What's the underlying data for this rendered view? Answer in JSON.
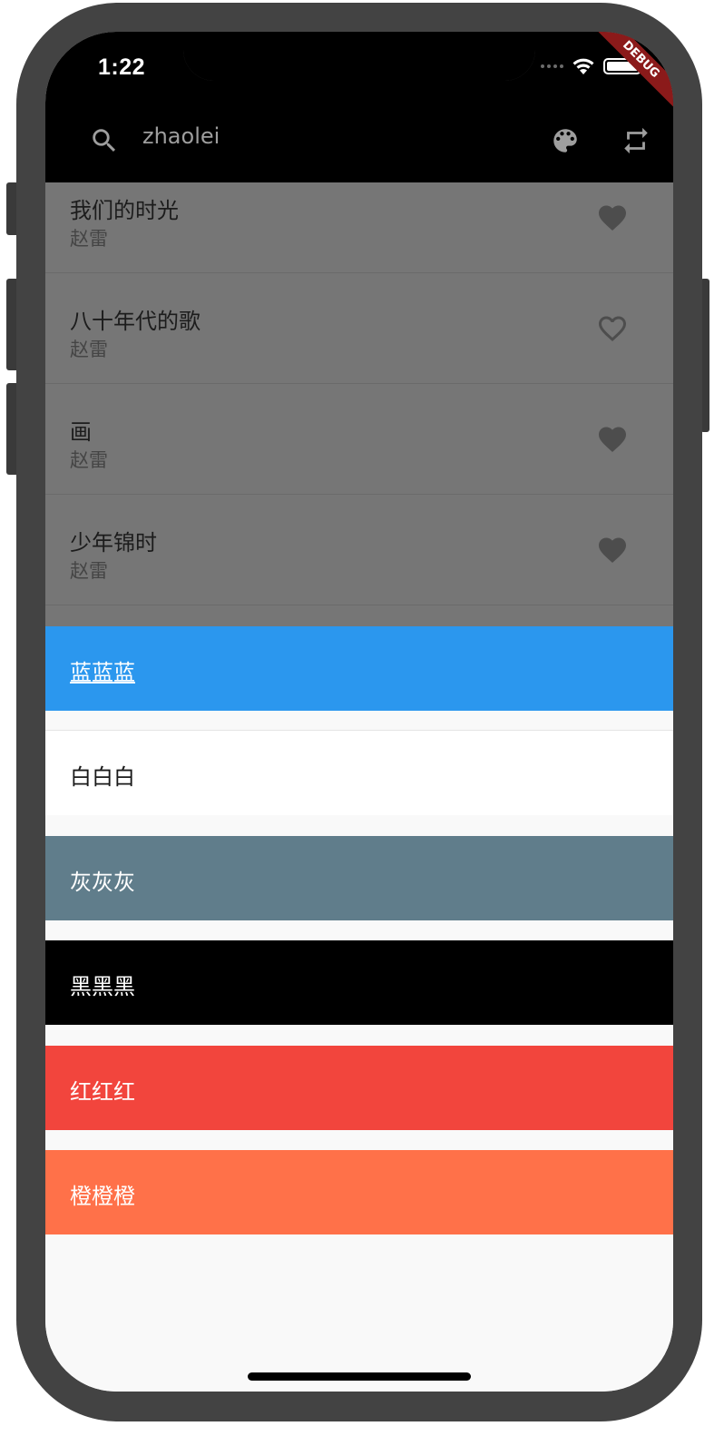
{
  "status_bar": {
    "time": "1:22"
  },
  "debug_banner": "DEBUG",
  "app_bar": {
    "search_text": "zhaolei",
    "search_icon": "search-icon",
    "palette_icon": "palette-icon",
    "repeat_icon": "repeat-icon"
  },
  "songs": [
    {
      "title": "我们的时光",
      "artist": "赵雷",
      "favorite": true
    },
    {
      "title": "八十年代的歌",
      "artist": "赵雷",
      "favorite": false
    },
    {
      "title": "画",
      "artist": "赵雷",
      "favorite": true
    },
    {
      "title": "少年锦时",
      "artist": "赵雷",
      "favorite": true
    }
  ],
  "theme_options": [
    {
      "label": "蓝蓝蓝",
      "bg": "#2b97ee",
      "fg": "#ffffff",
      "underline": true
    },
    {
      "label": "白白白",
      "bg": "#ffffff",
      "fg": "#1a1a1a",
      "underline": false
    },
    {
      "label": "灰灰灰",
      "bg": "#607d8b",
      "fg": "#ffffff",
      "underline": false
    },
    {
      "label": "黑黑黑",
      "bg": "#000000",
      "fg": "#ffffff",
      "underline": false
    },
    {
      "label": "红红红",
      "bg": "#f2453d",
      "fg": "#ffffff",
      "underline": false
    },
    {
      "label": "橙橙橙",
      "bg": "#ff7149",
      "fg": "#ffffff",
      "underline": false
    }
  ],
  "colors": {
    "overlay_list": "#767676",
    "heart": "#4d4d4d"
  }
}
